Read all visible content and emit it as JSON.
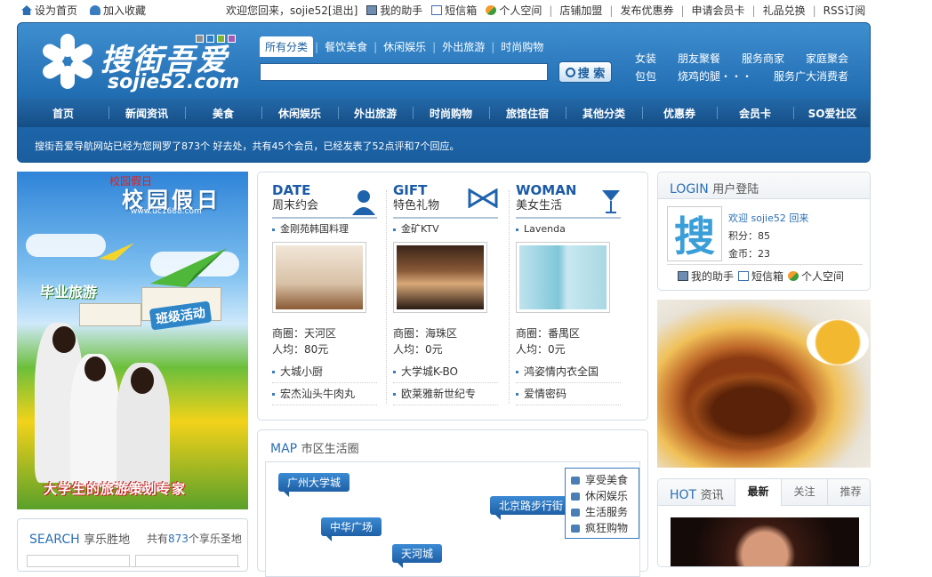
{
  "topbar": {
    "left": [
      "设为首页",
      "加入收藏"
    ],
    "welcome": "欢迎您回来，sojie52[退出]",
    "links": [
      "我的助手",
      "短信箱",
      "个人空间",
      "店铺加盟",
      "发布优惠券",
      "申请会员卡",
      "礼品兑换",
      "RSS订阅"
    ]
  },
  "header": {
    "logo_name": "搜街吾爱",
    "logo_url": "sojie52.com",
    "search_tabs": [
      "所有分类",
      "餐饮美食",
      "休闲娱乐",
      "外出旅游",
      "时尚购物"
    ],
    "search_value": "",
    "search_button": "搜 索",
    "quick_links": [
      "女装",
      "朋友聚餐",
      "服务商家",
      "家庭聚会",
      "包包",
      "烧鸡的腿・・・",
      "服务广大消费者"
    ],
    "nav": [
      "首页",
      "新闻资讯",
      "美食",
      "休闲娱乐",
      "外出旅游",
      "时尚购物",
      "旅馆住宿",
      "其他分类",
      "优惠券",
      "会员卡",
      "SO爱社区"
    ],
    "notice": "搜街吾爱导航网站已经为您网罗了873个  好去处，共有45个会员，已经发表了52点评和7个回应。"
  },
  "banner": {
    "top_label": "校园假日",
    "title": "校园假日",
    "sub": "www.uc1688.com",
    "badge1": "毕业旅游",
    "badge2": "班级活动",
    "bottom": "大学生的旅游策划专家"
  },
  "searchbox": {
    "title": "SEARCH",
    "title_zh": "享乐胜地",
    "count_prefix": "共有",
    "count": "873",
    "count_suffix": "个享乐圣地"
  },
  "sections": [
    {
      "en": "DATE",
      "zh": "周末约会",
      "icon": "person-icon",
      "first": "金刚苑韩国料理",
      "area": "商圈：天河区",
      "price": "人均：80元",
      "list": [
        "大城小厨",
        "宏杰汕头牛肉丸"
      ]
    },
    {
      "en": "GIFT",
      "zh": "特色礼物",
      "icon": "bow-icon",
      "first": "金矿KTV",
      "area": "商圈：海珠区",
      "price": "人均：0元",
      "list": [
        "大学城K-BO",
        "欧莱雅新世纪专"
      ]
    },
    {
      "en": "WOMAN",
      "zh": "美女生活",
      "icon": "cocktail-icon",
      "first": "Lavenda",
      "area": "商圈：番禺区",
      "price": "人均：0元",
      "list": [
        "鸿姿情内衣全国",
        "爱情密码"
      ]
    }
  ],
  "map": {
    "title": "MAP",
    "title_zh": "市区生活圈",
    "pins": [
      "广州大学城",
      "北京路步行街",
      "中华广场",
      "天河城"
    ],
    "legend": [
      "享受美食",
      "休闲娱乐",
      "生活服务",
      "疯狂购物"
    ]
  },
  "login": {
    "title": "LOGIN",
    "title_zh": "用户登陆",
    "avatar_char": "搜",
    "welcome": "欢迎 sojie52 回来",
    "points": "积分：85",
    "gold": "金币：23",
    "links": [
      "我的助手",
      "短信箱",
      "个人空间"
    ]
  },
  "hot": {
    "title": "HOT",
    "title_zh": "资讯",
    "tabs": [
      "最新",
      "关注",
      "推荐"
    ]
  },
  "colors": {
    "brand": "#1f6bb0",
    "accent": "#2a6fb6",
    "nav": "#144e86"
  }
}
